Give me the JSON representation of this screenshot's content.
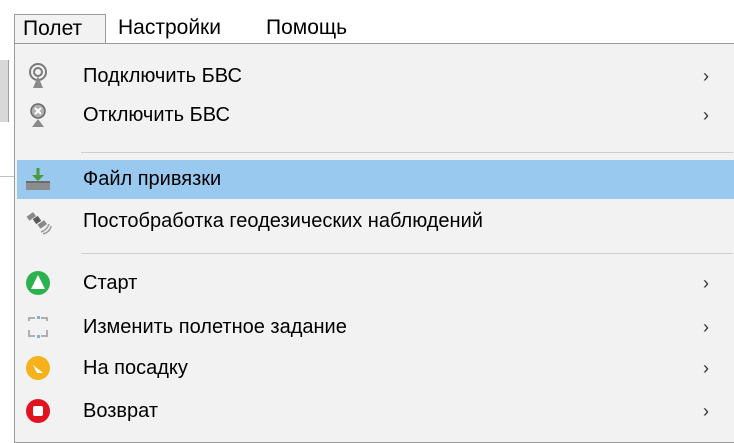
{
  "menubar": {
    "items": [
      {
        "label": "Полет"
      },
      {
        "label": "Настройки"
      },
      {
        "label": "Помощь"
      }
    ]
  },
  "menu": {
    "items": [
      {
        "label": "Подключить БВС",
        "icon": "connect-uav-icon",
        "submenu": "›"
      },
      {
        "label": "Отключить БВС",
        "icon": "disconnect-uav-icon",
        "submenu": "›"
      },
      {
        "label": "Файл привязки",
        "icon": "download-tray-icon",
        "highlighted": true
      },
      {
        "label": "Постобработка геодезических наблюдений",
        "icon": "satellite-icon"
      },
      {
        "label": "Старт",
        "icon": "takeoff-icon",
        "submenu": "›"
      },
      {
        "label": "Изменить полетное задание",
        "icon": "change-mission-icon",
        "submenu": "›"
      },
      {
        "label": "На посадку",
        "icon": "landing-icon",
        "submenu": "›"
      },
      {
        "label": "Возврат",
        "icon": "return-icon",
        "submenu": "›"
      }
    ]
  },
  "colors": {
    "highlight": "#99c9ef",
    "menu_background": "#f2f2f2",
    "start_green": "#2bb24c",
    "landing_orange": "#f5b21b",
    "return_red": "#e0141e"
  }
}
